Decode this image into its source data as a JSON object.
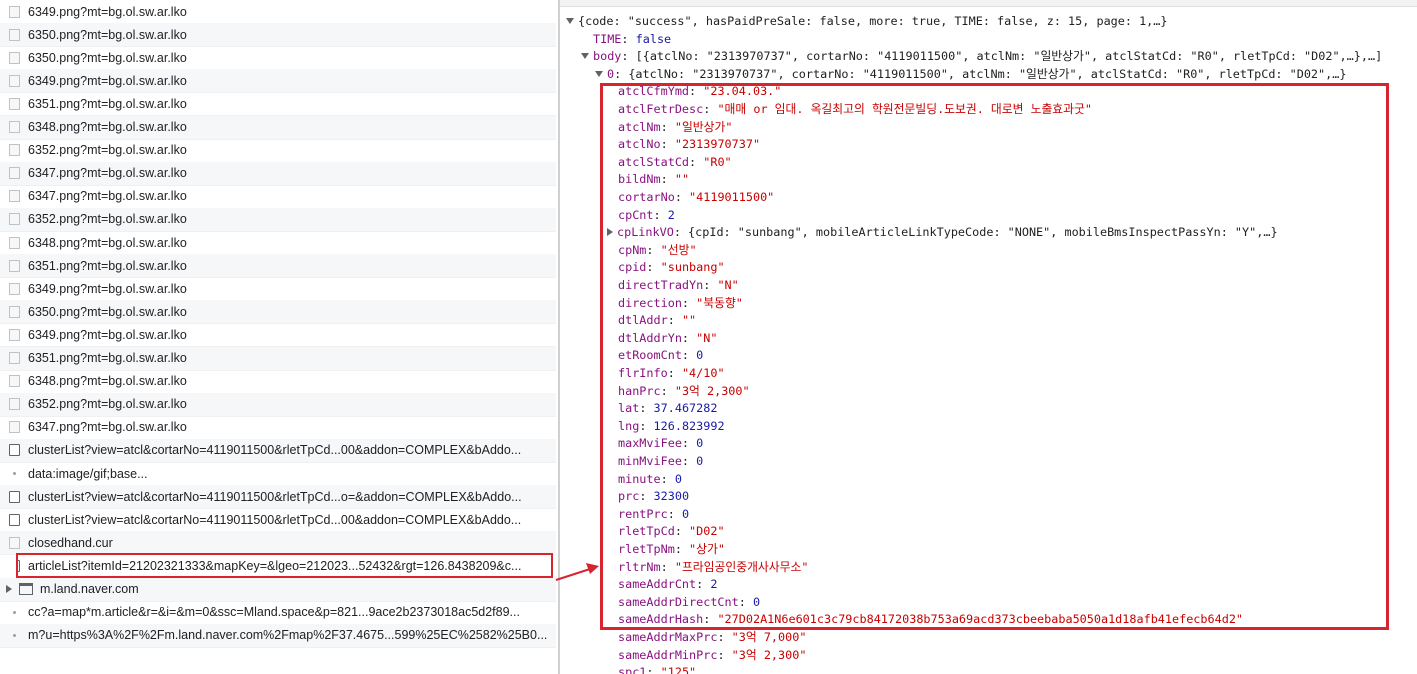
{
  "network": {
    "rows": [
      {
        "icon": "image-file-icon",
        "name": "6349.png?mt=bg.ol.sw.ar.lko"
      },
      {
        "icon": "image-file-icon",
        "name": "6350.png?mt=bg.ol.sw.ar.lko"
      },
      {
        "icon": "image-file-icon",
        "name": "6350.png?mt=bg.ol.sw.ar.lko"
      },
      {
        "icon": "image-file-icon",
        "name": "6349.png?mt=bg.ol.sw.ar.lko"
      },
      {
        "icon": "image-file-icon",
        "name": "6351.png?mt=bg.ol.sw.ar.lko"
      },
      {
        "icon": "image-file-icon",
        "name": "6348.png?mt=bg.ol.sw.ar.lko"
      },
      {
        "icon": "image-file-icon",
        "name": "6352.png?mt=bg.ol.sw.ar.lko"
      },
      {
        "icon": "image-file-icon",
        "name": "6347.png?mt=bg.ol.sw.ar.lko"
      },
      {
        "icon": "image-file-icon",
        "name": "6347.png?mt=bg.ol.sw.ar.lko"
      },
      {
        "icon": "image-file-icon",
        "name": "6352.png?mt=bg.ol.sw.ar.lko"
      },
      {
        "icon": "image-file-icon",
        "name": "6348.png?mt=bg.ol.sw.ar.lko"
      },
      {
        "icon": "image-file-icon",
        "name": "6351.png?mt=bg.ol.sw.ar.lko"
      },
      {
        "icon": "image-file-icon",
        "name": "6349.png?mt=bg.ol.sw.ar.lko"
      },
      {
        "icon": "image-file-icon",
        "name": "6350.png?mt=bg.ol.sw.ar.lko"
      },
      {
        "icon": "image-file-icon",
        "name": "6349.png?mt=bg.ol.sw.ar.lko"
      },
      {
        "icon": "image-file-icon",
        "name": "6351.png?mt=bg.ol.sw.ar.lko"
      },
      {
        "icon": "image-file-icon",
        "name": "6348.png?mt=bg.ol.sw.ar.lko"
      },
      {
        "icon": "image-file-icon",
        "name": "6352.png?mt=bg.ol.sw.ar.lko"
      },
      {
        "icon": "image-file-icon",
        "name": "6347.png?mt=bg.ol.sw.ar.lko"
      },
      {
        "icon": "document-icon",
        "name": "clusterList?view=atcl&cortarNo=4119011500&rletTpCd...00&addon=COMPLEX&bAddo..."
      },
      {
        "icon": "dot-icon",
        "name": "data:image/gif;base..."
      },
      {
        "icon": "document-icon",
        "name": "clusterList?view=atcl&cortarNo=4119011500&rletTpCd...o=&addon=COMPLEX&bAddo..."
      },
      {
        "icon": "document-icon",
        "name": "clusterList?view=atcl&cortarNo=4119011500&rletTpCd...00&addon=COMPLEX&bAddo..."
      },
      {
        "icon": "image-file-icon",
        "name": "closedhand.cur"
      },
      {
        "icon": "document-icon",
        "name": "articleList?itemId=21202321333&mapKey=&lgeo=212023...52432&rgt=126.8438209&c...",
        "selected": true
      },
      {
        "icon": "frame-group-icon",
        "name": "m.land.naver.com"
      },
      {
        "icon": "dot-icon",
        "name": "cc?a=map*m.article&r=&i=&m=0&ssc=Mland.space&p=821...9ace2b2373018ac5d2f89..."
      },
      {
        "icon": "dot-icon",
        "name": "m?u=https%3A%2F%2Fm.land.naver.com%2Fmap%2F37.4675...599%25EC%2582%25B0..."
      }
    ]
  },
  "preview": {
    "root": "{code: \"success\", hasPaidPreSale: false, more: true, TIME: false, z: 15, page: 1,…}",
    "time": {
      "k": "TIME",
      "v": "false"
    },
    "body": {
      "k": "body",
      "v": "[{atclNo: \"2313970737\", cortarNo: \"4119011500\", atclNm: \"일반상가\", atclStatCd: \"R0\", rletTpCd: \"D02\",…},…]"
    },
    "item0": {
      "k": "0",
      "v": "{atclNo: \"2313970737\", cortarNo: \"4119011500\", atclNm: \"일반상가\", atclStatCd: \"R0\", rletTpCd: \"D02\",…}"
    },
    "fields": [
      {
        "k": "atclCfmYmd",
        "v": "\"23.04.03.\"",
        "t": "s"
      },
      {
        "k": "atclFetrDesc",
        "v": "\"매매 or 임대. 옥길최고의 학원전문빌딩.도보권. 대로변 노출효과굿\"",
        "t": "s"
      },
      {
        "k": "atclNm",
        "v": "\"일반상가\"",
        "t": "s"
      },
      {
        "k": "atclNo",
        "v": "\"2313970737\"",
        "t": "s"
      },
      {
        "k": "atclStatCd",
        "v": "\"R0\"",
        "t": "s"
      },
      {
        "k": "bildNm",
        "v": "\"\"",
        "t": "s"
      },
      {
        "k": "cortarNo",
        "v": "\"4119011500\"",
        "t": "s"
      },
      {
        "k": "cpCnt",
        "v": "2",
        "t": "n"
      },
      {
        "k": "cpLinkVO",
        "v": "{cpId: \"sunbang\", mobileArticleLinkTypeCode: \"NONE\", mobileBmsInspectPassYn: \"Y\",…}",
        "t": "o"
      },
      {
        "k": "cpNm",
        "v": "\"선방\"",
        "t": "s"
      },
      {
        "k": "cpid",
        "v": "\"sunbang\"",
        "t": "s"
      },
      {
        "k": "directTradYn",
        "v": "\"N\"",
        "t": "s"
      },
      {
        "k": "direction",
        "v": "\"북동향\"",
        "t": "s"
      },
      {
        "k": "dtlAddr",
        "v": "\"\"",
        "t": "s"
      },
      {
        "k": "dtlAddrYn",
        "v": "\"N\"",
        "t": "s"
      },
      {
        "k": "etRoomCnt",
        "v": "0",
        "t": "n"
      },
      {
        "k": "flrInfo",
        "v": "\"4/10\"",
        "t": "s"
      },
      {
        "k": "hanPrc",
        "v": "\"3억 2,300\"",
        "t": "s"
      },
      {
        "k": "lat",
        "v": "37.467282",
        "t": "n"
      },
      {
        "k": "lng",
        "v": "126.823992",
        "t": "n"
      },
      {
        "k": "maxMviFee",
        "v": "0",
        "t": "n"
      },
      {
        "k": "minMviFee",
        "v": "0",
        "t": "n"
      },
      {
        "k": "minute",
        "v": "0",
        "t": "n"
      },
      {
        "k": "prc",
        "v": "32300",
        "t": "n"
      },
      {
        "k": "rentPrc",
        "v": "0",
        "t": "n"
      },
      {
        "k": "rletTpCd",
        "v": "\"D02\"",
        "t": "s"
      },
      {
        "k": "rletTpNm",
        "v": "\"상가\"",
        "t": "s"
      },
      {
        "k": "rltrNm",
        "v": "\"프라임공인중개사사무소\"",
        "t": "s"
      },
      {
        "k": "sameAddrCnt",
        "v": "2",
        "t": "n"
      },
      {
        "k": "sameAddrDirectCnt",
        "v": "0",
        "t": "n"
      },
      {
        "k": "sameAddrHash",
        "v": "\"27D02A1N6e601c3c79cb84172038b753a69acd373cbeebaba5050a1d18afb41efecb64d2\"",
        "t": "s"
      },
      {
        "k": "sameAddrMaxPrc",
        "v": "\"3억 7,000\"",
        "t": "s"
      },
      {
        "k": "sameAddrMinPrc",
        "v": "\"3억 2,300\"",
        "t": "s"
      },
      {
        "k": "spc1",
        "v": "\"125\"",
        "t": "s"
      }
    ]
  },
  "colors": {
    "highlight": "#d8242f",
    "key": "#881280",
    "string": "#c80000",
    "number": "#1a1aa6"
  }
}
